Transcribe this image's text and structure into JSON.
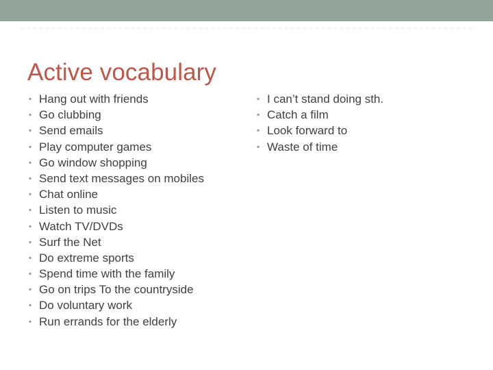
{
  "slide": {
    "title": "Active vocabulary",
    "title_color": "#c0564a",
    "banner_color": "#93a49b",
    "background_color": "#ffffff",
    "body_text_color": "#404040",
    "bullet_color": "#9a9a9a",
    "bullet_glyph": "▪",
    "rule_color": "#f4f7f5"
  },
  "columns": {
    "left": {
      "items": [
        {
          "text": "Hang out with friends"
        },
        {
          "text": "Go clubbing"
        },
        {
          "text": "Send emails"
        },
        {
          "text": "Play computer games"
        },
        {
          "text": "Go window shopping"
        },
        {
          "text": "Send text messages on mobiles"
        },
        {
          "text": "Chat online"
        },
        {
          "text": "Listen to music"
        },
        {
          "text": "Watch TV/DVDs"
        },
        {
          "text": "Surf the Net"
        },
        {
          "text": "Do extreme sports"
        },
        {
          "text": "Spend time with the family"
        },
        {
          "text": "Go on trips To the countryside"
        },
        {
          "text": "Do voluntary work"
        },
        {
          "text": "Run errands for the elderly"
        }
      ]
    },
    "right": {
      "items": [
        {
          "text": "I can’t stand doing sth."
        },
        {
          "text": "Catch a film"
        },
        {
          "text": "Look forward to"
        },
        {
          "text": "Waste of time"
        }
      ]
    }
  }
}
